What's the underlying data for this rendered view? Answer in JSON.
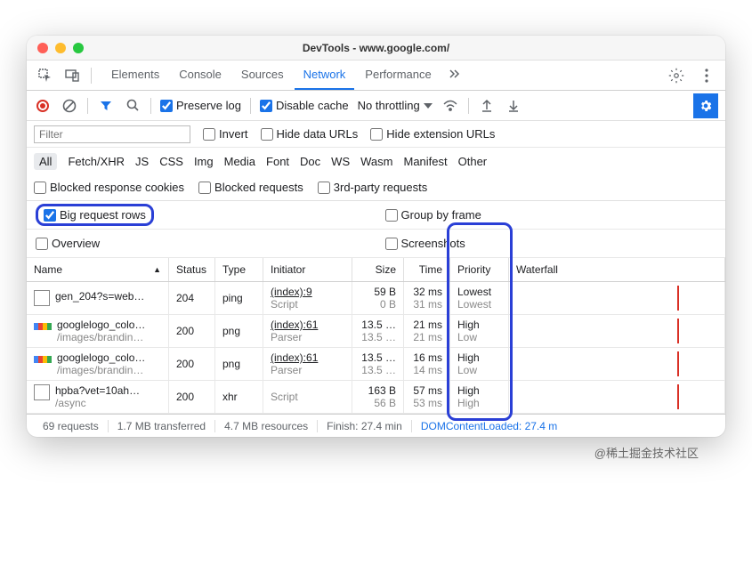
{
  "window": {
    "title": "DevTools - www.google.com/"
  },
  "tabs": {
    "items": [
      "Elements",
      "Console",
      "Sources",
      "Network",
      "Performance"
    ],
    "active_index": 3
  },
  "toolbar": {
    "preserve_log": {
      "label": "Preserve log",
      "checked": true
    },
    "disable_cache": {
      "label": "Disable cache",
      "checked": true
    },
    "throttling": "No throttling"
  },
  "filterbar": {
    "filter_placeholder": "Filter",
    "invert": "Invert",
    "hide_data_urls": "Hide data URLs",
    "hide_ext_urls": "Hide extension URLs"
  },
  "types": [
    "All",
    "Fetch/XHR",
    "JS",
    "CSS",
    "Img",
    "Media",
    "Font",
    "Doc",
    "WS",
    "Wasm",
    "Manifest",
    "Other"
  ],
  "blocked": {
    "resp_cookies": "Blocked response cookies",
    "requests": "Blocked requests",
    "third_party": "3rd-party requests"
  },
  "options": {
    "big_rows": "Big request rows",
    "group_frame": "Group by frame",
    "overview": "Overview",
    "screenshots": "Screenshots"
  },
  "columns": [
    "Name",
    "Status",
    "Type",
    "Initiator",
    "Size",
    "Time",
    "Priority",
    "Waterfall"
  ],
  "rows": [
    {
      "icon": "blank",
      "name": "gen_204?s=web…",
      "path": "",
      "status": "204",
      "type": "ping",
      "init": "(index):9",
      "init_sub": "Script",
      "size": "59 B",
      "size_sub": "0 B",
      "time": "32 ms",
      "time_sub": "31 ms",
      "prio": "Lowest",
      "prio_sub": "Lowest"
    },
    {
      "icon": "google",
      "name": "googlelogo_colo…",
      "path": "/images/brandin…",
      "status": "200",
      "type": "png",
      "init": "(index):61",
      "init_sub": "Parser",
      "size": "13.5 …",
      "size_sub": "13.5 …",
      "time": "21 ms",
      "time_sub": "21 ms",
      "prio": "High",
      "prio_sub": "Low"
    },
    {
      "icon": "google",
      "name": "googlelogo_colo…",
      "path": "/images/brandin…",
      "status": "200",
      "type": "png",
      "init": "(index):61",
      "init_sub": "Parser",
      "size": "13.5 …",
      "size_sub": "13.5 …",
      "time": "16 ms",
      "time_sub": "14 ms",
      "prio": "High",
      "prio_sub": "Low"
    },
    {
      "icon": "blank",
      "name": "hpba?vet=10ah…",
      "path": "/async",
      "status": "200",
      "type": "xhr",
      "init": "",
      "init_sub": "Script",
      "size": "163 B",
      "size_sub": "56 B",
      "time": "57 ms",
      "time_sub": "53 ms",
      "prio": "High",
      "prio_sub": "High"
    }
  ],
  "status": {
    "requests": "69 requests",
    "transferred": "1.7 MB transferred",
    "resources": "4.7 MB resources",
    "finish": "Finish: 27.4 min",
    "dcl": "DOMContentLoaded: 27.4 m"
  },
  "watermark": "@稀土掘金技术社区"
}
